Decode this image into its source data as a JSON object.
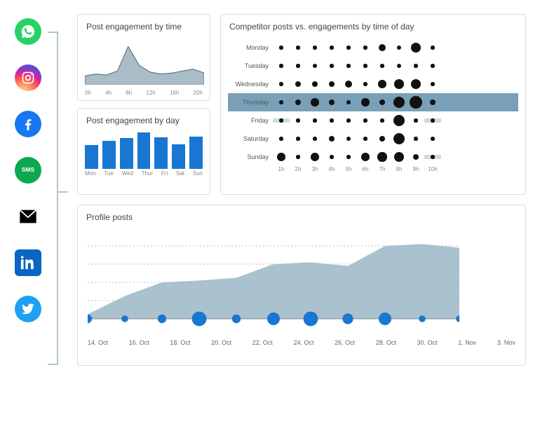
{
  "icons": [
    "whatsapp",
    "instagram",
    "facebook",
    "sms",
    "email",
    "linkedin",
    "twitter"
  ],
  "panels": {
    "engagement_time": {
      "title": "Post engagement by time"
    },
    "engagement_day": {
      "title": "Post engagement by day"
    },
    "competitor": {
      "title": "Competitor posts vs. engagements by time of day"
    },
    "profile_posts": {
      "title": "Profile posts"
    }
  },
  "chart_data": [
    {
      "type": "area",
      "id": "engagement_time",
      "title": "Post engagement by time",
      "x": [
        0,
        2,
        4,
        6,
        8,
        10,
        12,
        14,
        16,
        18,
        20,
        22
      ],
      "values": [
        18,
        22,
        20,
        28,
        78,
        40,
        26,
        22,
        24,
        28,
        32,
        24
      ],
      "tick_labels": [
        "0h",
        "4h",
        "8h",
        "12h",
        "16h",
        "20h"
      ],
      "ylim": [
        0,
        100
      ],
      "fill": "#a9bcc8",
      "stroke": "#4a6674"
    },
    {
      "type": "bar",
      "id": "engagement_day",
      "title": "Post engagement by day",
      "categories": [
        "Mon",
        "Tue",
        "Wed",
        "Thur",
        "Fri",
        "Sat",
        "Sun"
      ],
      "values": [
        60,
        72,
        78,
        92,
        80,
        62,
        82
      ],
      "ylim": [
        0,
        100
      ],
      "color": "#1976d2"
    },
    {
      "type": "heatmap",
      "id": "competitor",
      "title": "Competitor posts vs. engagements by time of day",
      "y_categories": [
        "Monday",
        "Tuesday",
        "Wednesday",
        "Thursday",
        "Friday",
        "Saturday",
        "Sunday"
      ],
      "x_categories": [
        "1h",
        "2h",
        "3h",
        "4h",
        "5h",
        "6h",
        "7h",
        "8h",
        "9h",
        "10h"
      ],
      "values": [
        [
          2,
          2,
          2,
          2,
          2,
          2,
          5,
          3,
          8,
          2
        ],
        [
          2,
          2,
          3,
          2,
          2,
          2,
          2,
          3,
          2,
          2
        ],
        [
          2,
          4,
          4,
          4,
          5,
          2,
          6,
          8,
          8,
          2
        ],
        [
          2,
          4,
          6,
          4,
          2,
          6,
          4,
          9,
          10,
          4
        ],
        [
          2,
          2,
          2,
          2,
          2,
          2,
          2,
          9,
          2,
          2
        ],
        [
          2,
          2,
          2,
          4,
          3,
          2,
          4,
          9,
          2,
          2
        ],
        [
          6,
          2,
          6,
          2,
          2,
          6,
          7,
          8,
          4,
          2
        ]
      ],
      "highlight_row_index": 3,
      "highlight_cells": [
        [
          4,
          0
        ],
        [
          4,
          9
        ],
        [
          6,
          9
        ]
      ]
    },
    {
      "type": "area",
      "id": "profile_posts",
      "title": "Profile posts",
      "x_labels": [
        "14. Oct",
        "16. Oct",
        "18. Oct",
        "20. Oct",
        "22. Oct",
        "24. Oct",
        "26. Oct",
        "28. Oct",
        "30. Oct",
        "1. Nov",
        "3. Nov"
      ],
      "values": [
        5,
        25,
        40,
        42,
        45,
        60,
        62,
        58,
        80,
        82,
        78
      ],
      "bubble_sizes": [
        3,
        2,
        3,
        6,
        3,
        5,
        6,
        4,
        5,
        2,
        2
      ],
      "ylim": [
        0,
        100
      ],
      "fill": "#9bb6c6",
      "bubble_color": "#1976d2"
    }
  ]
}
